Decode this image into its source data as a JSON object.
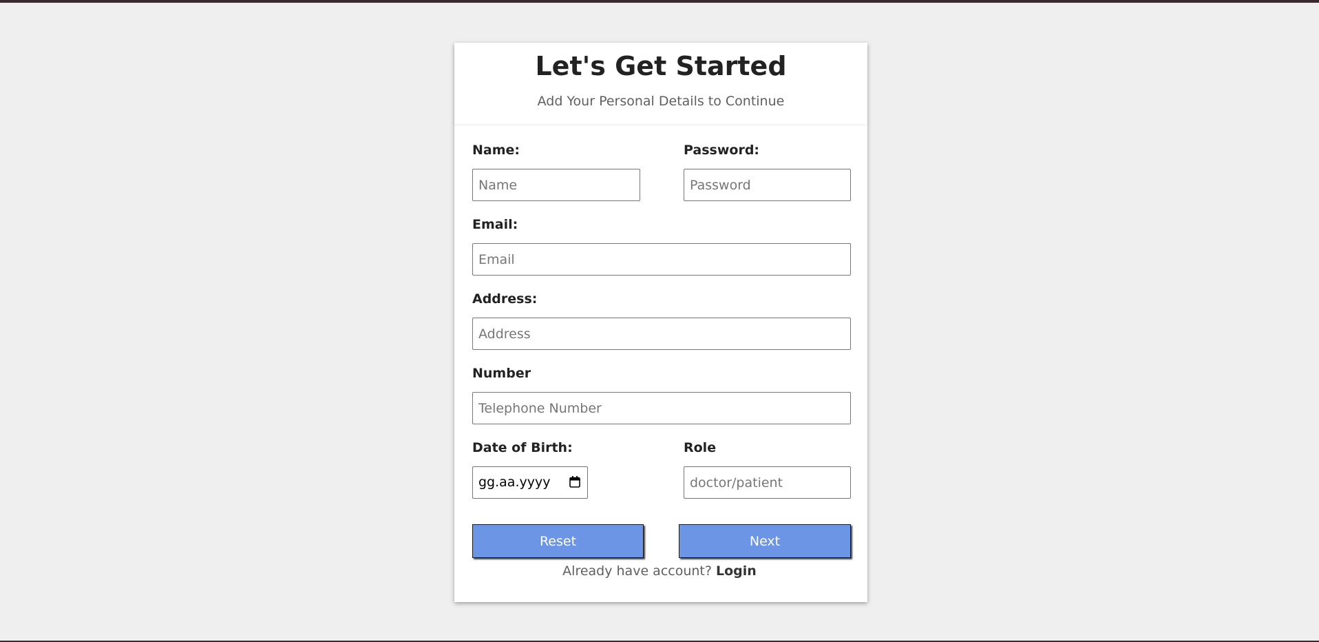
{
  "header": {
    "title": "Let's Get Started",
    "subtitle": "Add Your Personal Details to Continue"
  },
  "form": {
    "name": {
      "label": "Name:",
      "placeholder": "Name",
      "value": ""
    },
    "password": {
      "label": "Password:",
      "placeholder": "Password",
      "value": ""
    },
    "email": {
      "label": "Email:",
      "placeholder": "Email",
      "value": ""
    },
    "address": {
      "label": "Address:",
      "placeholder": "Address",
      "value": ""
    },
    "number": {
      "label": "Number",
      "placeholder": "Telephone Number",
      "value": ""
    },
    "dob": {
      "label": "Date of Birth:",
      "display_value": "gg.aa.yyyy",
      "icon": "calendar-icon"
    },
    "role": {
      "label": "Role",
      "placeholder": "doctor/patient",
      "value": ""
    }
  },
  "actions": {
    "reset_label": "Reset",
    "next_label": "Next"
  },
  "footer": {
    "prompt": "Already have account?",
    "login_label": "Login"
  },
  "colors": {
    "page_background": "#efefef",
    "card_background": "#ffffff",
    "button_background": "#6d95e6",
    "top_bar": "#3a2a30"
  }
}
